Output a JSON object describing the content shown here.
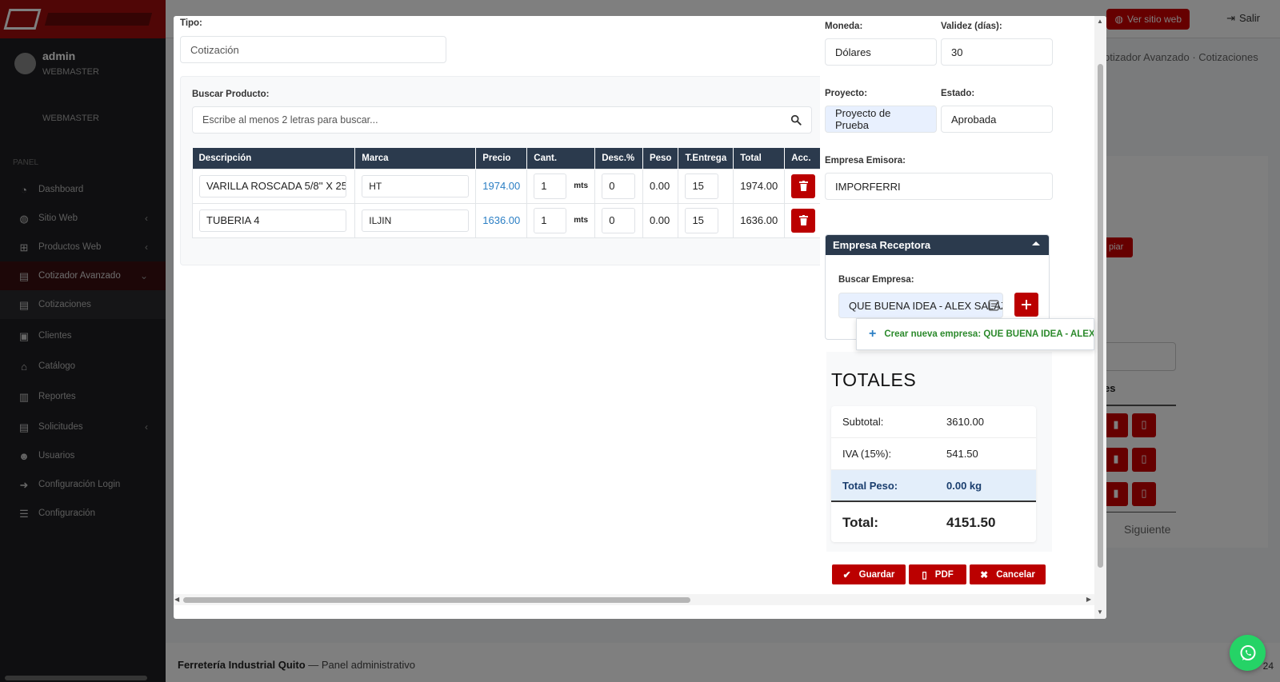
{
  "background": {
    "sidebar": {
      "user_name": "admin",
      "user_role": "WEBMASTER",
      "user_role_2": "WEBMASTER",
      "section_label": "PANEL",
      "items": [
        {
          "label": "Dashboard",
          "icon": "dashboard-icon"
        },
        {
          "label": "Sitio Web",
          "icon": "globe-icon"
        },
        {
          "label": "Productos Web",
          "icon": "sitemap-icon"
        },
        {
          "label": "Cotizador Avanzado",
          "icon": "file-icon"
        },
        {
          "label": "Cotizaciones",
          "icon": "file-text-icon"
        },
        {
          "label": "Clientes",
          "icon": "address-book-icon"
        },
        {
          "label": "Catálogo",
          "icon": "store-icon"
        },
        {
          "label": "Reportes",
          "icon": "bar-chart-icon"
        },
        {
          "label": "Solicitudes",
          "icon": "file-icon"
        },
        {
          "label": "Usuarios",
          "icon": "users-icon"
        },
        {
          "label": "Configuración Login",
          "icon": "sign-in-icon"
        },
        {
          "label": "Configuración",
          "icon": "sliders-icon"
        }
      ]
    },
    "topbar": {
      "site_button": "Ver sitio web",
      "exit_button": "Salir"
    },
    "breadcrumb": "otizador Avanzado · Cotizaciones",
    "bg_button": "piar",
    "table_header_fragment": "es",
    "next_label": "Siguiente",
    "footer": {
      "company": "Ferretería Industrial Quito",
      "suffix": " — Panel administrativo",
      "version": "24"
    }
  },
  "modal": {
    "tipo": {
      "label": "Tipo:",
      "value": "Cotización"
    },
    "producto": {
      "label": "Buscar Producto:",
      "placeholder": "Escribe al menos 2 letras para buscar..."
    },
    "table": {
      "headers": [
        "Descripción",
        "Marca",
        "Precio",
        "Cant.",
        "Desc.%",
        "Peso",
        "T.Entrega",
        "Total",
        "Acc."
      ],
      "rows": [
        {
          "descripcion": "VARILLA ROSCADA 5/8'' X 25",
          "marca": "HT",
          "precio": "1974.00",
          "cant": "1",
          "unidad": "mts",
          "desc": "0",
          "peso": "0.00",
          "entrega": "15",
          "total": "1974.00"
        },
        {
          "descripcion": "TUBERIA 4",
          "marca": "ILJIN",
          "precio": "1636.00",
          "cant": "1",
          "unidad": "mts",
          "desc": "0",
          "peso": "0.00",
          "entrega": "15",
          "total": "1636.00"
        }
      ]
    },
    "moneda": {
      "label": "Moneda:",
      "value": "Dólares"
    },
    "validez": {
      "label": "Validez (días):",
      "value": "30"
    },
    "proyecto": {
      "label": "Proyecto:",
      "value": "Proyecto de Prueba"
    },
    "estado": {
      "label": "Estado:",
      "value": "Aprobada"
    },
    "emisora": {
      "label": "Empresa Emisora:",
      "value": "IMPORFERRI"
    },
    "receptora": {
      "title": "Empresa Receptora",
      "buscar_label": "Buscar Empresa:",
      "buscar_value": "QUE BUENA IDEA - ALEX SALAZ",
      "suggestion": "Crear nueva empresa: QUE BUENA IDEA - ALEX SALAZ"
    },
    "totales": {
      "title": "TOTALES",
      "subtotal_label": "Subtotal:",
      "subtotal": "3610.00",
      "iva_label": "IVA (15%):",
      "iva": "541.50",
      "peso_label": "Total Peso:",
      "peso": "0.00 kg",
      "total_label": "Total:",
      "total": "4151.50"
    },
    "actions": {
      "guardar": "Guardar",
      "pdf": "PDF",
      "cancelar": "Cancelar"
    }
  },
  "colors": {
    "primary_red": "#b00000",
    "table_header": "#2b3a4d",
    "price_blue": "#2a7ec4",
    "suggestion_green": "#2c8a2c"
  }
}
